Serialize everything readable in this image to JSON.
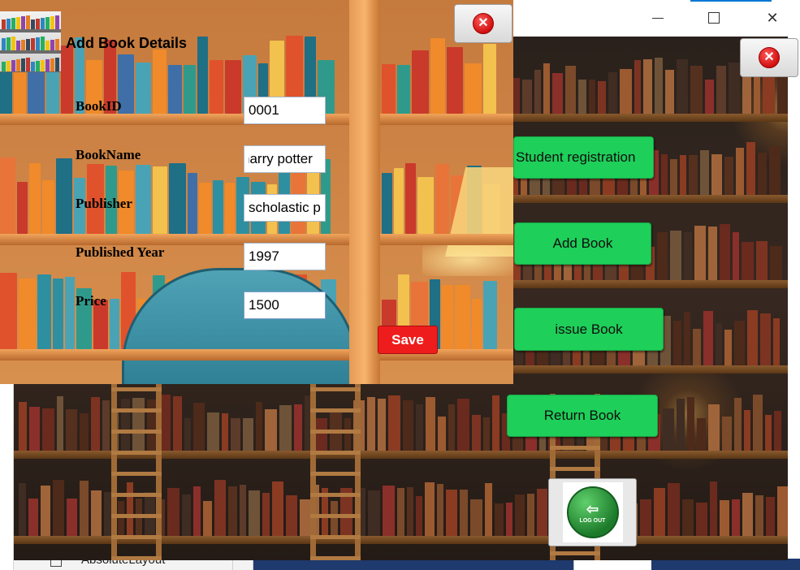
{
  "ide": {
    "palette_item_label": "AbsoluteLayout"
  },
  "main_window": {
    "controls": {
      "minimize": "minimize-icon",
      "maximize": "maximize-icon",
      "close": "close-icon"
    },
    "menu": {
      "student_registration": "Student registration",
      "add_book": "Add Book",
      "issue_book": "issue Book",
      "return_book": "Return Book"
    },
    "logout_text": "LOG OUT",
    "close_icon": "close-icon",
    "button_color": "#1ecf5a"
  },
  "dialog": {
    "title": "Add Book Details",
    "fields": {
      "book_id": {
        "label": "BookID",
        "value": "0001"
      },
      "book_name": {
        "label": "BookName",
        "value": "harry potter"
      },
      "publisher": {
        "label": "Publisher",
        "value": "scholastic p"
      },
      "published_year": {
        "label": "Published Year",
        "value": "1997"
      },
      "price": {
        "label": "Price",
        "value": "1500"
      }
    },
    "save_label": "Save",
    "save_color": "#ee1c1c",
    "close_icon": "close-icon"
  }
}
